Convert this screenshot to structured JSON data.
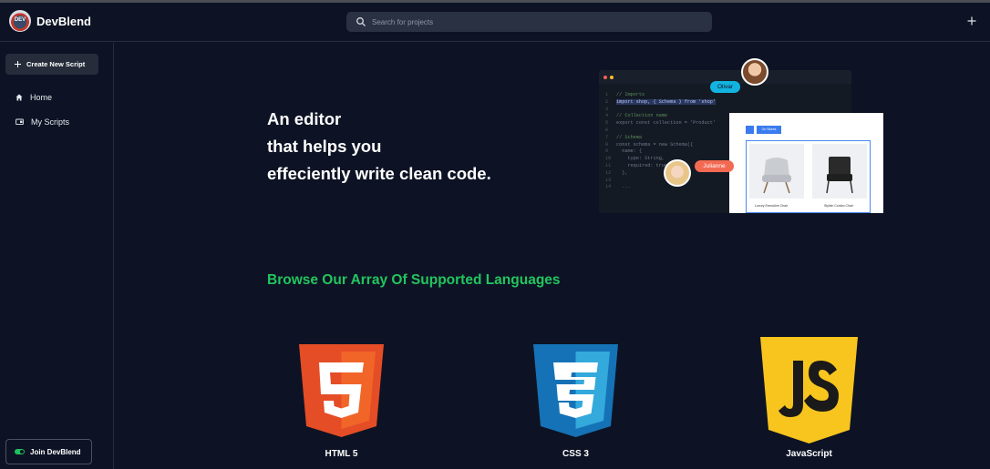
{
  "app": {
    "name": "DevBlend",
    "logo_text": "DEV"
  },
  "header": {
    "search_placeholder": "Search for projects"
  },
  "sidebar": {
    "create_label": "Create New Script",
    "items": [
      {
        "label": "Home",
        "icon": "home-icon"
      },
      {
        "label": "My Scripts",
        "icon": "scripts-icon"
      }
    ],
    "join_label": "Join DevBlend"
  },
  "hero": {
    "line1": "An editor",
    "line2": "that helps you",
    "line3": "effeciently write clean code."
  },
  "mockup": {
    "collaborators": [
      "Olivar",
      "Julianne"
    ],
    "code_lines": [
      {
        "n": "1",
        "t": "// Imports"
      },
      {
        "n": "2",
        "t": "import shop, { Schema } from 'shop'"
      },
      {
        "n": "3",
        "t": ""
      },
      {
        "n": "4",
        "t": "// Collection name"
      },
      {
        "n": "5",
        "t": "export const collection = 'Product'"
      },
      {
        "n": "6",
        "t": ""
      },
      {
        "n": "7",
        "t": "// Schema"
      },
      {
        "n": "8",
        "t": "const schema = new Schema({"
      },
      {
        "n": "9",
        "t": "  name: {"
      },
      {
        "n": "10",
        "t": "    type: String,"
      },
      {
        "n": "11",
        "t": "    required: true"
      },
      {
        "n": "12",
        "t": "  },"
      },
      {
        "n": "13",
        "t": ""
      },
      {
        "n": "14",
        "t": "  ..."
      }
    ],
    "shop_button": "On Stores",
    "products": [
      "Luxury Executive Chair",
      "Stylish Combo Chair"
    ]
  },
  "languages_section": {
    "title": "Browse Our Array Of Supported Languages",
    "languages": [
      {
        "name": "HTML 5",
        "icon": "html5-icon",
        "color": "#e44d26"
      },
      {
        "name": "CSS 3",
        "icon": "css3-icon",
        "color": "#1572b6"
      },
      {
        "name": "JavaScript",
        "icon": "javascript-icon",
        "color": "#f7c51e"
      }
    ]
  },
  "colors": {
    "background": "#0d1324",
    "accent": "#22c55e",
    "search_bg": "#2a3142"
  }
}
